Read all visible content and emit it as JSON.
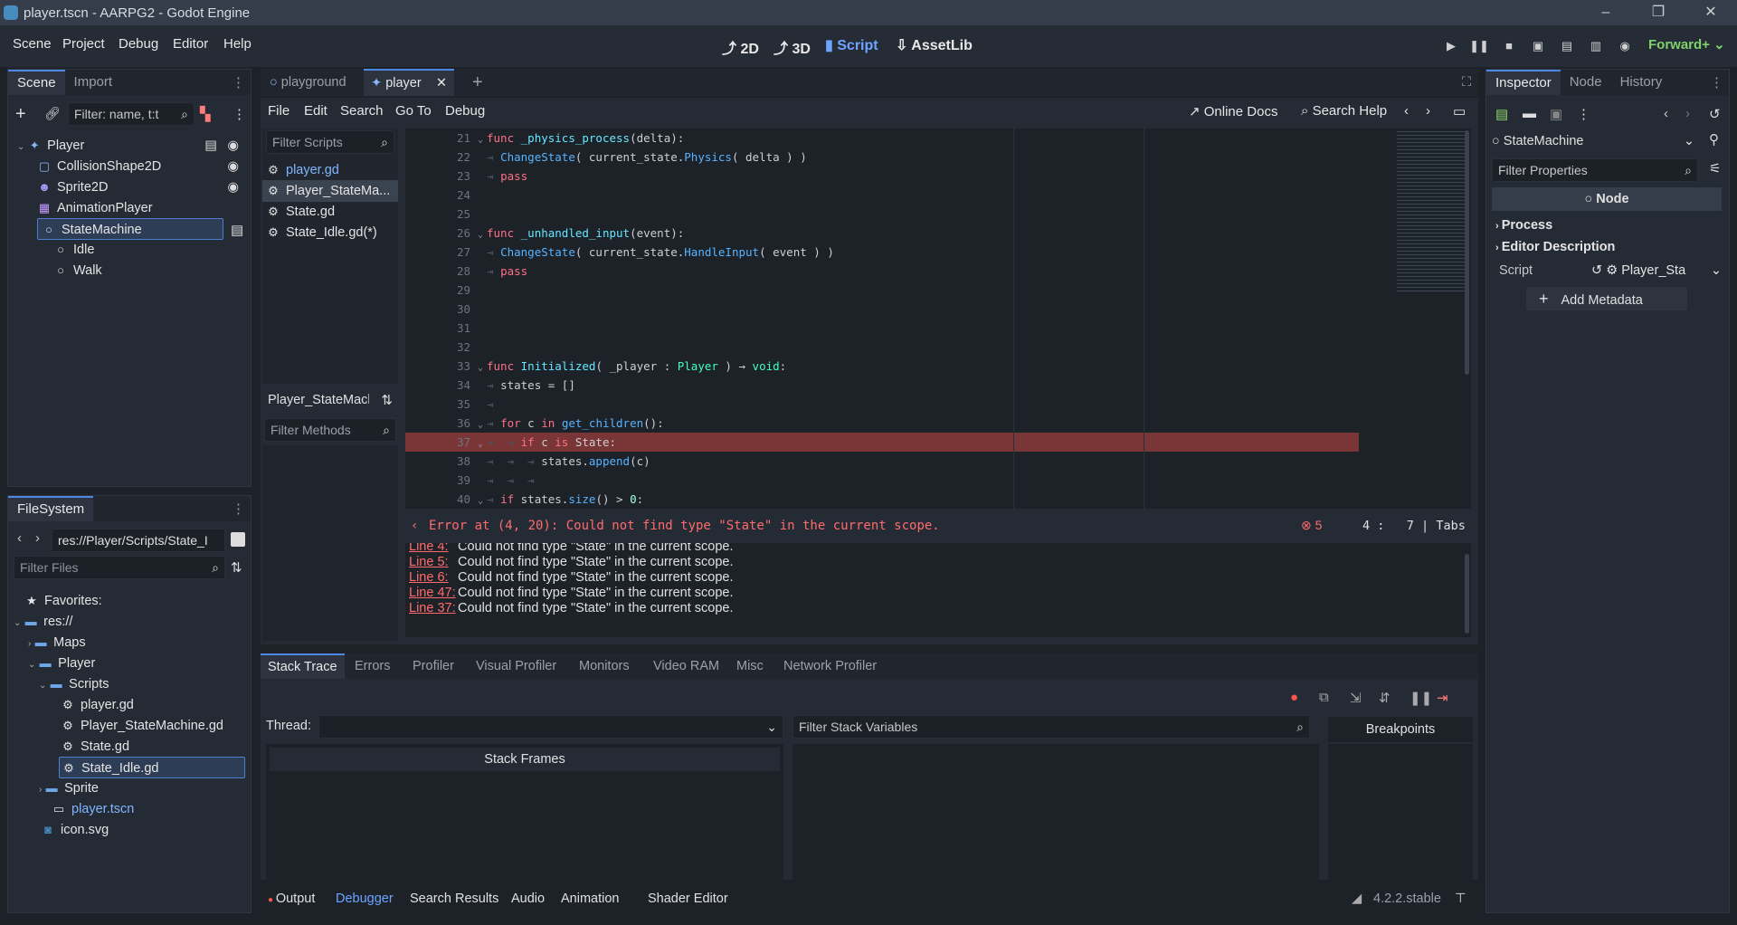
{
  "window": {
    "title": "player.tscn - AARPG2 - Godot Engine",
    "controls": [
      "–",
      "❐",
      "✕"
    ]
  },
  "menu": {
    "items": [
      "Scene",
      "Project",
      "Debug",
      "Editor",
      "Help"
    ]
  },
  "workspaces": [
    {
      "label": "2D",
      "icon": "2d-icon"
    },
    {
      "label": "3D",
      "icon": "3d-icon"
    },
    {
      "label": "Script",
      "icon": "script-icon",
      "active": true
    },
    {
      "label": "AssetLib",
      "icon": "assetlib-icon"
    }
  ],
  "renderer": "Forward+",
  "scene_panel": {
    "tabs": [
      "Scene",
      "Import"
    ],
    "filter_placeholder": "Filter: name, t:t",
    "nodes": [
      {
        "label": "Player",
        "icon": "player-node-icon",
        "depth": 0
      },
      {
        "label": "CollisionShape2D",
        "icon": "collision-icon",
        "depth": 1
      },
      {
        "label": "Sprite2D",
        "icon": "sprite-icon",
        "depth": 1
      },
      {
        "label": "AnimationPlayer",
        "icon": "animation-icon",
        "depth": 1
      },
      {
        "label": "StateMachine",
        "icon": "node-icon",
        "depth": 1,
        "selected": true
      },
      {
        "label": "Idle",
        "icon": "node-icon",
        "depth": 2
      },
      {
        "label": "Walk",
        "icon": "node-icon",
        "depth": 2
      }
    ]
  },
  "filesystem": {
    "title": "FileSystem",
    "path": "res://Player/Scripts/State_I",
    "filter_placeholder": "Filter Files",
    "items": [
      {
        "label": "Favorites:",
        "icon": "star-icon",
        "depth": 0
      },
      {
        "label": "res://",
        "icon": "folder-icon",
        "depth": 0
      },
      {
        "label": "Maps",
        "icon": "folder-icon",
        "depth": 1
      },
      {
        "label": "Player",
        "icon": "folder-icon",
        "depth": 1
      },
      {
        "label": "Scripts",
        "icon": "folder-icon",
        "depth": 2
      },
      {
        "label": "player.gd",
        "icon": "gear-icon",
        "depth": 3
      },
      {
        "label": "Player_StateMachine.gd",
        "icon": "gear-icon",
        "depth": 3
      },
      {
        "label": "State.gd",
        "icon": "gear-icon",
        "depth": 3
      },
      {
        "label": "State_Idle.gd",
        "icon": "gear-icon",
        "depth": 3,
        "selected": true
      },
      {
        "label": "Sprite",
        "icon": "folder-icon",
        "depth": 2
      },
      {
        "label": "player.tscn",
        "icon": "scene-icon",
        "depth": 2,
        "link": true
      },
      {
        "label": "icon.svg",
        "icon": "image-icon",
        "depth": 1
      }
    ]
  },
  "scene_tabs": [
    {
      "label": "playground"
    },
    {
      "label": "player",
      "active": true
    }
  ],
  "script_menu": [
    "File",
    "Edit",
    "Search",
    "Go To",
    "Debug"
  ],
  "script_toolbar": {
    "online_docs": "Online Docs",
    "search_help": "Search Help"
  },
  "script_list": {
    "filter_placeholder": "Filter Scripts",
    "items": [
      {
        "label": "player.gd",
        "active_link": true
      },
      {
        "label": "Player_StateMa...",
        "selected": true
      },
      {
        "label": "State.gd"
      },
      {
        "label": "State_Idle.gd(*)"
      }
    ],
    "current": "Player_StateMach",
    "methods_placeholder": "Filter Methods"
  },
  "code": [
    {
      "n": "21",
      "fold": true,
      "t": [
        [
          "kw",
          "func "
        ],
        [
          "fn",
          "_physics_process"
        ],
        [
          "cm",
          "(delta):"
        ]
      ]
    },
    {
      "n": "22",
      "t": [
        [
          "tb",
          "⇥ "
        ],
        [
          "call",
          "ChangeState"
        ],
        [
          "cm",
          "( current_state."
        ],
        [
          "call",
          "Physics"
        ],
        [
          "cm",
          "( delta ) )"
        ]
      ]
    },
    {
      "n": "23",
      "t": [
        [
          "tb",
          "⇥ "
        ],
        [
          "kw",
          "pass"
        ]
      ]
    },
    {
      "n": "24",
      "t": []
    },
    {
      "n": "25",
      "t": []
    },
    {
      "n": "26",
      "fold": true,
      "t": [
        [
          "kw",
          "func "
        ],
        [
          "fn",
          "_unhandled_input"
        ],
        [
          "cm",
          "(event):"
        ]
      ]
    },
    {
      "n": "27",
      "t": [
        [
          "tb",
          "⇥ "
        ],
        [
          "call",
          "ChangeState"
        ],
        [
          "cm",
          "( current_state."
        ],
        [
          "call",
          "HandleInput"
        ],
        [
          "cm",
          "( event ) )"
        ]
      ]
    },
    {
      "n": "28",
      "t": [
        [
          "tb",
          "⇥ "
        ],
        [
          "kw",
          "pass"
        ]
      ]
    },
    {
      "n": "29",
      "t": []
    },
    {
      "n": "30",
      "t": []
    },
    {
      "n": "31",
      "t": []
    },
    {
      "n": "32",
      "t": []
    },
    {
      "n": "33",
      "fold": true,
      "t": [
        [
          "kw",
          "func "
        ],
        [
          "fn",
          "Initialized"
        ],
        [
          "cm",
          "( _player : "
        ],
        [
          "ty",
          "Player"
        ],
        [
          "cm",
          " ) → "
        ],
        [
          "ty",
          "void"
        ],
        [
          "cm",
          ":"
        ]
      ]
    },
    {
      "n": "34",
      "t": [
        [
          "tb",
          "⇥ "
        ],
        [
          "cm",
          "states = []"
        ]
      ]
    },
    {
      "n": "35",
      "t": [
        [
          "tb",
          "⇥"
        ]
      ]
    },
    {
      "n": "36",
      "fold": true,
      "t": [
        [
          "tb",
          "⇥ "
        ],
        [
          "kw",
          "for "
        ],
        [
          "cm",
          "c "
        ],
        [
          "kw",
          "in "
        ],
        [
          "call",
          "get_children"
        ],
        [
          "cm",
          "():"
        ]
      ]
    },
    {
      "n": "37",
      "fold": true,
      "error": true,
      "t": [
        [
          "tb",
          "⇥  ⇥ "
        ],
        [
          "kw",
          "if "
        ],
        [
          "cm",
          "c "
        ],
        [
          "kw",
          "is "
        ],
        [
          "cm",
          "State:"
        ]
      ]
    },
    {
      "n": "38",
      "t": [
        [
          "tb",
          "⇥  ⇥  ⇥ "
        ],
        [
          "cm",
          "states."
        ],
        [
          "call",
          "append"
        ],
        [
          "cm",
          "(c)"
        ]
      ]
    },
    {
      "n": "39",
      "t": [
        [
          "tb",
          "⇥  ⇥  ⇥"
        ]
      ]
    },
    {
      "n": "40",
      "fold": true,
      "t": [
        [
          "tb",
          "⇥ "
        ],
        [
          "kw",
          "if "
        ],
        [
          "cm",
          "states."
        ],
        [
          "call",
          "size"
        ],
        [
          "cm",
          "() > "
        ],
        [
          "nm",
          "0"
        ],
        [
          "cm",
          ":"
        ]
      ]
    }
  ],
  "status": {
    "error": "Error at (4, 20): Could not find type \"State\" in the current scope.",
    "error_count": "5",
    "line": "4",
    "col": "7",
    "indent": "Tabs"
  },
  "errors": [
    {
      "link": "Line 4:",
      "msg": "Could not find type \"State\" in the current scope."
    },
    {
      "link": "Line 5:",
      "msg": "Could not find type \"State\" in the current scope."
    },
    {
      "link": "Line 6:",
      "msg": "Could not find type \"State\" in the current scope."
    },
    {
      "link": "Line 47:",
      "msg": "Could not find type \"State\" in the current scope."
    },
    {
      "link": "Line 37:",
      "msg": "Could not find type \"State\" in the current scope."
    }
  ],
  "debugger": {
    "tabs": [
      "Stack Trace",
      "Errors",
      "Profiler",
      "Visual Profiler",
      "Monitors",
      "Video RAM",
      "Misc",
      "Network Profiler"
    ],
    "thread_label": "Thread:",
    "filter_vars_placeholder": "Filter Stack Variables",
    "breakpoints": "Breakpoints",
    "stack_frames": "Stack Frames"
  },
  "bottom_bar": {
    "items": [
      "Output",
      "Debugger",
      "Search Results",
      "Audio",
      "Animation",
      "Shader Editor"
    ],
    "version": "4.2.2.stable"
  },
  "inspector": {
    "tabs": [
      "Inspector",
      "Node",
      "History"
    ],
    "object": "StateMachine",
    "filter_placeholder": "Filter Properties",
    "class": "Node",
    "sections": [
      "Process",
      "Editor Description"
    ],
    "script_label": "Script",
    "script_value": "Player_Sta",
    "add_metadata": "Add Metadata"
  },
  "colors": {
    "accent": "#4d88e6",
    "error": "#ff6b6b",
    "panel": "#252b35"
  }
}
